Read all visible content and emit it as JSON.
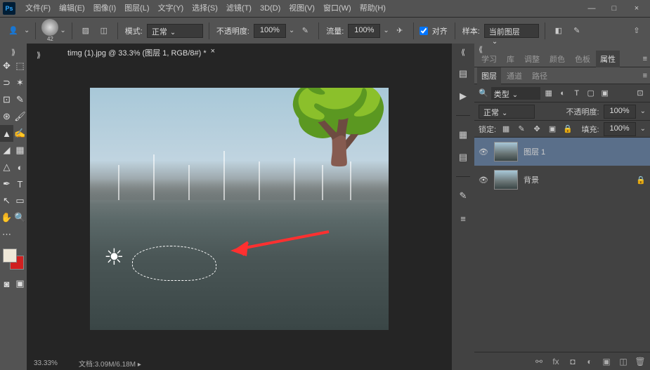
{
  "app": {
    "logo": "Ps"
  },
  "menu": [
    "文件(F)",
    "编辑(E)",
    "图像(I)",
    "图层(L)",
    "文字(Y)",
    "选择(S)",
    "滤镜(T)",
    "3D(D)",
    "视图(V)",
    "窗口(W)",
    "帮助(H)"
  ],
  "options": {
    "brush_size": "42",
    "mode_label": "模式:",
    "mode_value": "正常",
    "opacity_label": "不透明度:",
    "opacity_value": "100%",
    "flow_label": "流量:",
    "flow_value": "100%",
    "align_label": "对齐",
    "sample_label": "样本:",
    "sample_value": "当前图层"
  },
  "document": {
    "tab_title": "timg (1).jpg @ 33.3% (图层 1, RGB/8#) *",
    "zoom": "33.33%",
    "doc_label": "文档:",
    "doc_size": "3.09M/6.18M"
  },
  "colors": {
    "fg": "#f0e8d8",
    "bg": "#d02020"
  },
  "panel_tabs_top": [
    "学习",
    "库",
    "调整",
    "颜色",
    "色板",
    "属性"
  ],
  "panel_tabs_layer": [
    "图层",
    "通道",
    "路径"
  ],
  "layer_panel": {
    "filter_value": "类型",
    "blend_value": "正常",
    "opacity_label": "不透明度:",
    "opacity_value": "100%",
    "lock_label": "锁定:",
    "fill_label": "填充:",
    "fill_value": "100%"
  },
  "layers": [
    {
      "name": "图层 1",
      "locked": false
    },
    {
      "name": "背景",
      "locked": true
    }
  ]
}
